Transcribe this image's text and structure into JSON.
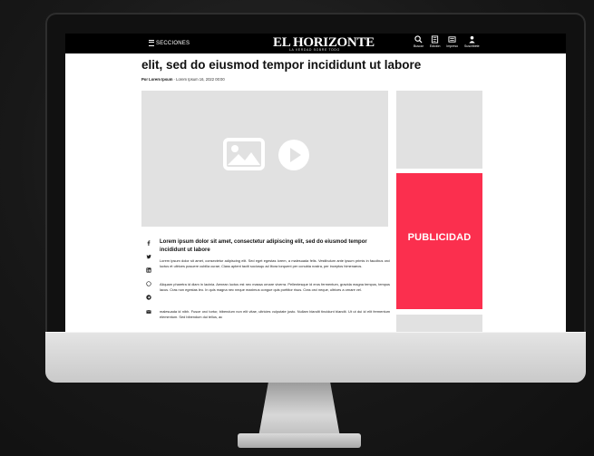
{
  "site": {
    "menu_label": "SECCIONES",
    "logo": "EL HORIZONTE",
    "tagline": "LA VERDAD SOBRE TODO",
    "tools": [
      {
        "label": "Buscar",
        "icon": "search-icon"
      },
      {
        "label": "Edición",
        "icon": "newspaper-icon"
      },
      {
        "label": "Impreso",
        "icon": "print-icon"
      },
      {
        "label": "Suscribete",
        "icon": "user-icon"
      }
    ]
  },
  "article": {
    "headline": "elit, sed do eiusmod tempor incididunt ut labore",
    "byline_author": "Por Lorem Ipsum",
    "byline_date": "Lorem Ipsum 16, 2022 00:00",
    "lede": "Lorem ipsum dolor sit amet, consectetur adipiscing elit, sed do eiusmod tempor incididunt ut labore",
    "paragraphs": [
      "Lorem ipsum dolor sit amet, consectetur adipiscing elit. Sed eget egestas lorem, a malesuada felis. Vestibulum ante ipsum primis in faucibus orci luctus et ultrices posuere cubilia curae; Class aptent taciti sociosqu ad litora torquent per conubia nostra, per inceptos himenaeos.",
      "Aliquam pharetra id diam in lacinia. Aenean luctus est nec massa ornare viverra. Pellentesque id eros fermentum, gravida magna tempus, tempus lacus. Cras non egestas leo. In quis magna nec neque maximus congue quis porttitor risus. Cras orci neque, ultrices a ornare vel.",
      "malesuada id nibh. Fusce orci tortor, bibendum non elit vitae, ultricies vulputate justo. Nullam blandit tincidunt blandit. Ut ut dui id elit fermentum elementum. Sed bibendum dui tellus, ac"
    ]
  },
  "share_icons": [
    "facebook-icon",
    "twitter-icon",
    "linkedin-icon",
    "whatsapp-icon",
    "telegram-icon",
    "mail-icon"
  ],
  "sidebar": {
    "ad_label": "PUBLICIDAD",
    "ad_color": "#fb2f4e"
  }
}
